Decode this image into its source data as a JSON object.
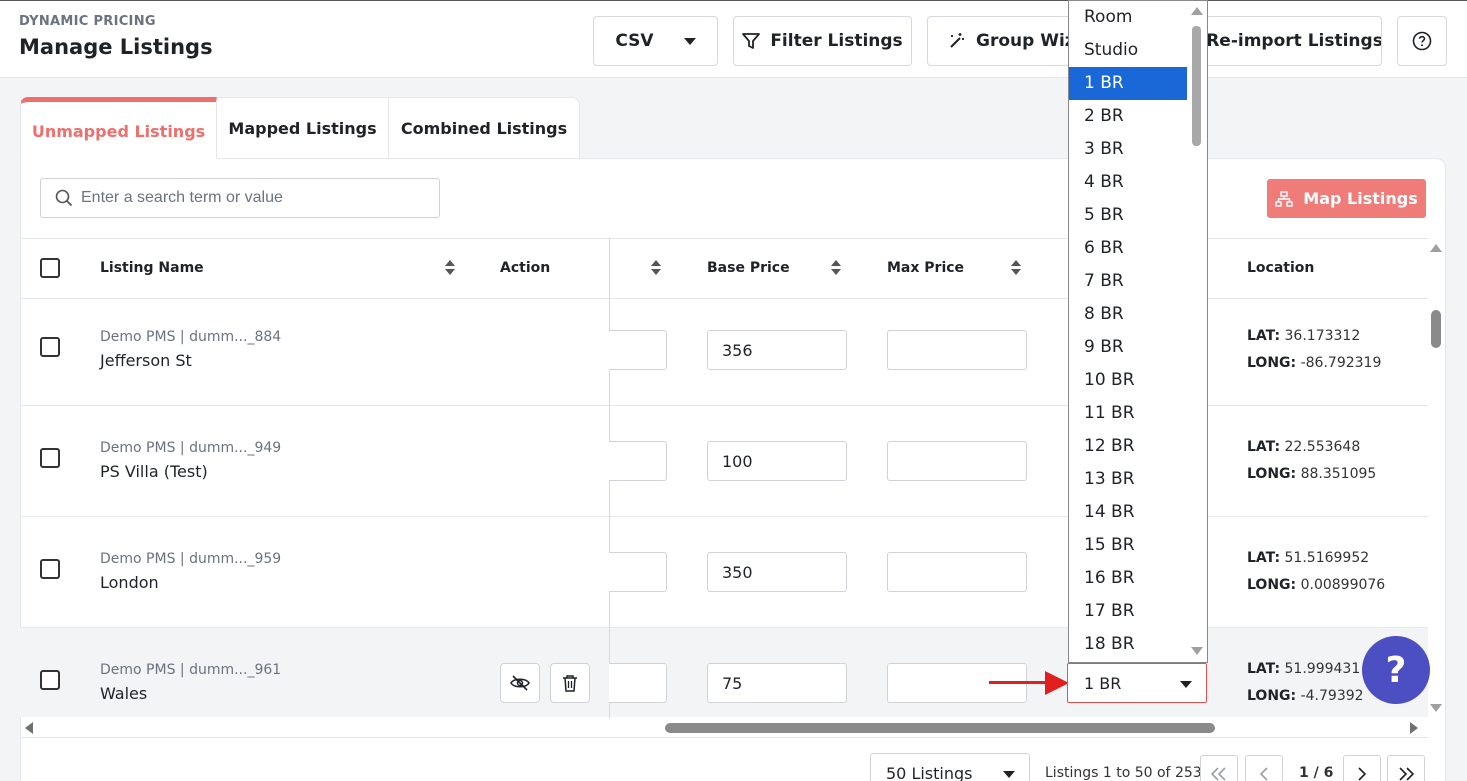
{
  "header": {
    "eyebrow": "DYNAMIC PRICING",
    "title": "Manage Listings",
    "csv_label": "CSV",
    "filter_label": "Filter Listings",
    "group_label": "Group Wiza",
    "reimport_label": "/Re-import Listings",
    "help_icon": "question-circle-icon"
  },
  "tabs": [
    {
      "label": "Unmapped Listings",
      "active": true
    },
    {
      "label": "Mapped Listings",
      "active": false
    },
    {
      "label": "Combined Listings",
      "active": false
    }
  ],
  "search": {
    "placeholder": "Enter a search term or value"
  },
  "map_button": {
    "label": "Map Listings"
  },
  "table": {
    "columns": {
      "listing_name": "Listing Name",
      "action": "Action",
      "base_price": "Base Price",
      "max_price": "Max Price",
      "location": "Location"
    },
    "lat_label": "LAT:",
    "long_label": "LONG:",
    "rows": [
      {
        "source": "Demo PMS | dumm..._884",
        "name": "Jefferson St",
        "base_price": "356",
        "max_price": "",
        "lat": "36.173312",
        "long": "-86.792319"
      },
      {
        "source": "Demo PMS | dumm..._949",
        "name": "PS Villa (Test)",
        "base_price": "100",
        "max_price": "",
        "lat": "22.553648",
        "long": "88.351095"
      },
      {
        "source": "Demo PMS | dumm..._959",
        "name": "London",
        "base_price": "350",
        "max_price": "",
        "lat": "51.5169952",
        "long": "0.00899076"
      },
      {
        "source": "Demo PMS | dumm..._961",
        "name": "Wales",
        "base_price": "75",
        "max_price": "",
        "lat": "51.999431",
        "long": "-4.79392",
        "bedroom": "1 BR"
      }
    ]
  },
  "dropdown": {
    "options": [
      "Room",
      "Studio",
      "1 BR",
      "2 BR",
      "3 BR",
      "4 BR",
      "5 BR",
      "6 BR",
      "7 BR",
      "8 BR",
      "9 BR",
      "10 BR",
      "11 BR",
      "12 BR",
      "13 BR",
      "14 BR",
      "15 BR",
      "16 BR",
      "17 BR",
      "18 BR"
    ],
    "selected": "1 BR"
  },
  "footer": {
    "per_page": "50 Listings",
    "count_text": "Listings 1 to 50 of 253",
    "page_text": "1 / 6"
  },
  "help_bubble": "?",
  "colors": {
    "accent": "#ef6f6c",
    "map_button": "#f07c7a",
    "selected_option": "#1a68d8",
    "help_bubble": "#4c4fc2",
    "annotation_arrow": "#e21f1f"
  }
}
